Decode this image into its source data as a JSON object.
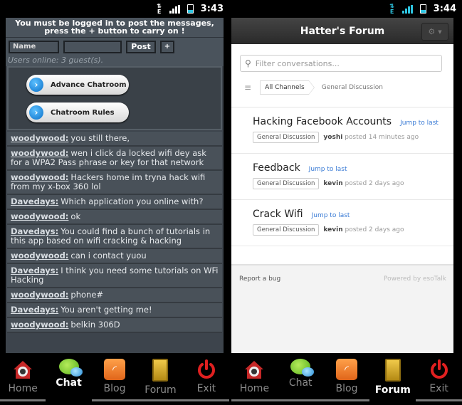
{
  "left": {
    "status_time": "3:43",
    "login_notice": "You must be logged in to post the messages, press the + button to carry on !",
    "name_placeholder": "Name",
    "message_value": "",
    "post_label": "Post",
    "plus_label": "+",
    "users_online": "Users online: 3 guest(s).",
    "menu_buttons": [
      {
        "label": "Advance Chatroom",
        "icon": "chevron-right-icon"
      },
      {
        "label": "Chatroom Rules",
        "icon": "chevron-right-icon"
      }
    ],
    "messages": [
      {
        "author": "woodywood:",
        "text": "you still there,"
      },
      {
        "author": "woodywood:",
        "text": "wen i click da locked wifi dey ask for a WPA2 Pass phrase or key for that network"
      },
      {
        "author": "woodywood:",
        "text": "Hackers home im tryna hack wifi from my x-box 360 lol"
      },
      {
        "author": "Davedays:",
        "text": "Which application you online with?"
      },
      {
        "author": "woodywood:",
        "text": "ok"
      },
      {
        "author": "Davedays:",
        "text": "You could find a bunch of tutorials in this app based on wifi cracking & hacking"
      },
      {
        "author": "woodywood:",
        "text": "can i contact yuou"
      },
      {
        "author": "Davedays:",
        "text": "I think you need some tutorials on WFi Hacking"
      },
      {
        "author": "woodywood:",
        "text": "phone#"
      },
      {
        "author": "Davedays:",
        "text": "You aren't getting me!"
      },
      {
        "author": "woodywood:",
        "text": "belkin 306D"
      }
    ],
    "active_tab": "Chat"
  },
  "right": {
    "status_time": "3:44",
    "title": "Hatter's Forum",
    "search_placeholder": "Filter conversations...",
    "breadcrumb": {
      "all": "All Channels",
      "current": "General Discussion"
    },
    "conversations": [
      {
        "title": "Hacking Facebook Accounts",
        "jump": "Jump to last",
        "channel": "General Discussion",
        "user": "yoshi",
        "meta": "posted 14 minutes ago"
      },
      {
        "title": "Feedback",
        "jump": "Jump to last",
        "channel": "General Discussion",
        "user": "kevin",
        "meta": "posted 2 days ago"
      },
      {
        "title": "Crack Wifi",
        "jump": "Jump to last",
        "channel": "General Discussion",
        "user": "kevin",
        "meta": "posted 2 days ago"
      }
    ],
    "footer": {
      "report": "Report a bug",
      "powered": "Powered by esoTalk"
    },
    "active_tab": "Forum"
  },
  "tabs": [
    {
      "label": "Home",
      "icon": "home-icon"
    },
    {
      "label": "Chat",
      "icon": "chat-icon"
    },
    {
      "label": "Blog",
      "icon": "rss-icon"
    },
    {
      "label": "Forum",
      "icon": "forum-door-icon"
    },
    {
      "label": "Exit",
      "icon": "power-icon"
    }
  ],
  "colors": {
    "link_blue": "#3a7bd5",
    "chat_bg": "#3d444c",
    "status_accent": "#2ec4e0",
    "exit_red": "#e02020"
  }
}
